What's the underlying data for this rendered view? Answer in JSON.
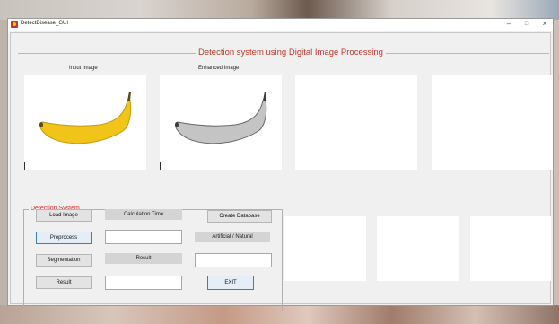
{
  "window": {
    "title": "DetectDisease_GUI",
    "controls": {
      "minimize": "–",
      "maximize": "□",
      "close": "×"
    }
  },
  "heading": "Detection system using Digital Image Processing",
  "images": {
    "input_label": "Input Image",
    "enhanced_label": "Enhanced Image"
  },
  "panel": {
    "title": "Detection System",
    "load_image": "Load Image",
    "calculation_time": "Calculation Time",
    "create_database": "Create Database",
    "preprocess": "Preprocess",
    "artificial_natural": "Artificial /  Natural",
    "segmentation": "Segmentation",
    "result_label": "Result",
    "result_button": "Result",
    "exit": "EXIT"
  },
  "colors": {
    "heading": "#c0392b",
    "group_title": "#d62c2c",
    "banana_yellow": "#f0c419",
    "banana_gray": "#b8b8b8"
  }
}
